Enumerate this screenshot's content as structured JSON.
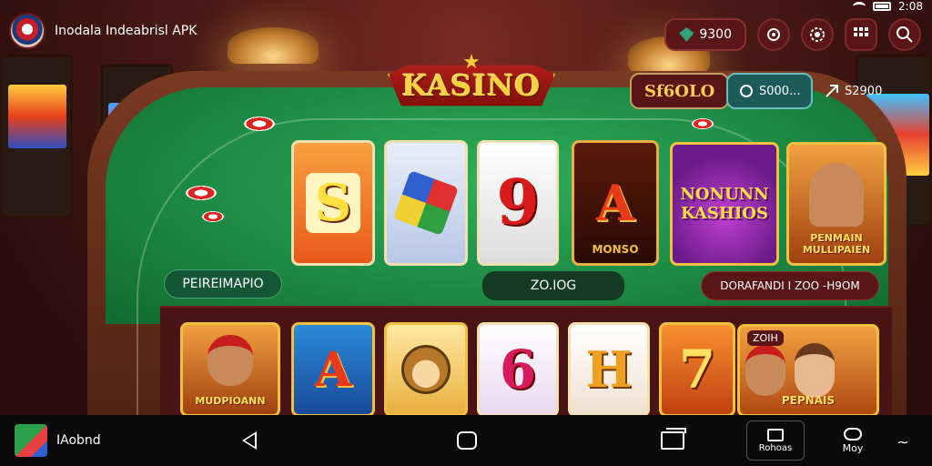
{
  "status_bar": {
    "time": "2:08"
  },
  "header": {
    "app_name": "Inodala Indeabrisl APK",
    "balance": "9300",
    "icons": [
      "gem-icon",
      "share-icon",
      "settings-icon",
      "grid-icon",
      "search-icon"
    ]
  },
  "table": {
    "logo_text": "KASINO",
    "score": "Sf6OLO",
    "coins": "S000...",
    "send_label": "S2900"
  },
  "row1": {
    "tiles": [
      {
        "glyph": "S",
        "caption": ""
      },
      {
        "glyph": "",
        "caption": ""
      },
      {
        "glyph": "9",
        "caption": ""
      },
      {
        "glyph": "A",
        "caption": "MONSO"
      },
      {
        "glyph": "NONUNN KASHIOS",
        "caption": ""
      },
      {
        "glyph": "",
        "caption": "PENMAIN MULLIPAIEN"
      }
    ],
    "left_label": "PEIREIMAPIO",
    "center_label": "ZO.IOG",
    "right_label": "DORAFANDI I ZOO -H9OM"
  },
  "row2": {
    "tiles": [
      {
        "glyph": "",
        "caption": "MUDPIOANN"
      },
      {
        "glyph": "A",
        "caption": ""
      },
      {
        "glyph": "",
        "caption": ""
      },
      {
        "glyph": "6",
        "caption": ""
      },
      {
        "glyph": "H",
        "caption": ""
      },
      {
        "glyph": "7",
        "caption": ""
      },
      {
        "glyph": "",
        "caption": "PEPNAIS",
        "badge": "ZOIH"
      }
    ]
  },
  "nav": {
    "app_label": "IAobnd",
    "notice_label": "Rohoas",
    "more_label": "Moy",
    "end_label": "∼"
  }
}
